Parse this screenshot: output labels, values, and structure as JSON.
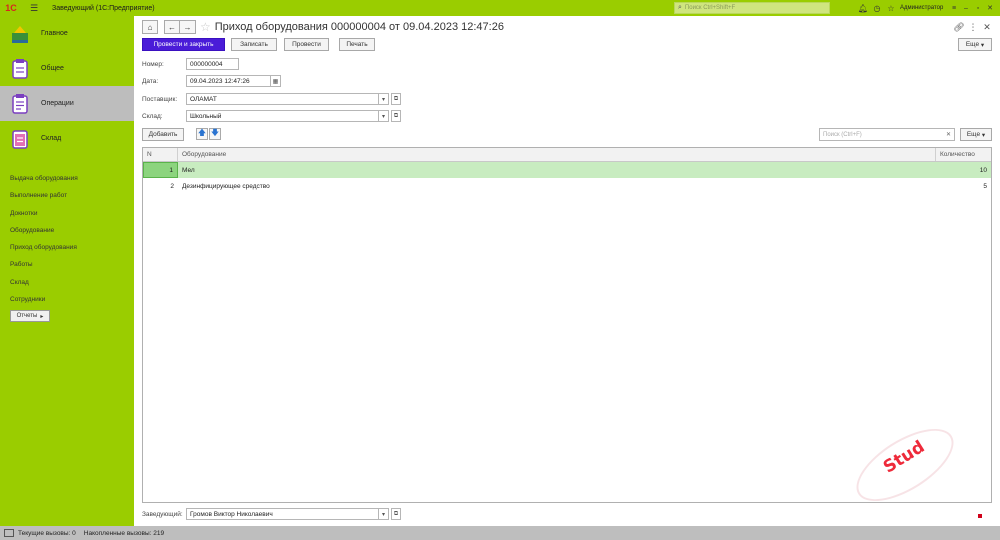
{
  "titlebar": {
    "title": "Заведующий (1С:Предприятие)",
    "search_placeholder": "Поиск Ctrl+Shift+F",
    "user": "Администратор"
  },
  "sidebar": {
    "sections": [
      {
        "label": "Главное",
        "icon": "home-icon"
      },
      {
        "label": "Общее",
        "icon": "general-icon"
      },
      {
        "label": "Операции",
        "icon": "operations-icon"
      },
      {
        "label": "Склад",
        "icon": "warehouse-icon"
      }
    ],
    "active_section": "Операции",
    "nav_items": [
      "Выдача оборудования",
      "Выполнение работ",
      "Докнотки",
      "Оборудование",
      "Приход оборудования",
      "Работы",
      "Склад",
      "Сотрудники"
    ],
    "reports_label": "Отчеты"
  },
  "form": {
    "title": "Приход оборудования 000000004 от 09.04.2023 12:47:26",
    "more_label": "Еще",
    "buttons": {
      "post_close": "Провести и закрыть",
      "save": "Записать",
      "post": "Провести",
      "print": "Печать"
    },
    "fields": {
      "number_label": "Номер:",
      "number_value": "000000004",
      "date_label": "Дата:",
      "date_value": "09.04.2023 12:47:26",
      "supplier_label": "Поставщик:",
      "supplier_value": "ОЛАМАТ",
      "warehouse_label": "Склад:",
      "warehouse_value": "Школьный"
    },
    "table": {
      "add_label": "Добавить",
      "search_placeholder": "Поиск (Ctrl+F)",
      "more_label": "Еще",
      "columns": [
        "N",
        "Оборудование",
        "Количество"
      ],
      "rows": [
        {
          "n": "1",
          "equipment": "Мел",
          "qty": "10",
          "selected": true
        },
        {
          "n": "2",
          "equipment": "Дезинфицирующее средство",
          "qty": "5",
          "selected": false
        }
      ]
    },
    "manager_label": "Заведующий:",
    "manager_value": "Громов Виктор Николаевич"
  },
  "statusbar": {
    "current_calls": "Текущие вызовы: 0",
    "accumulated_calls": "Накопленные вызовы: 219"
  },
  "watermark": "Stud",
  "colors": {
    "titlebar": "#9acd00",
    "sidebar": "#9acd00",
    "primary_button": "#4a1cd8",
    "selected_row": "#c8ecc0"
  }
}
